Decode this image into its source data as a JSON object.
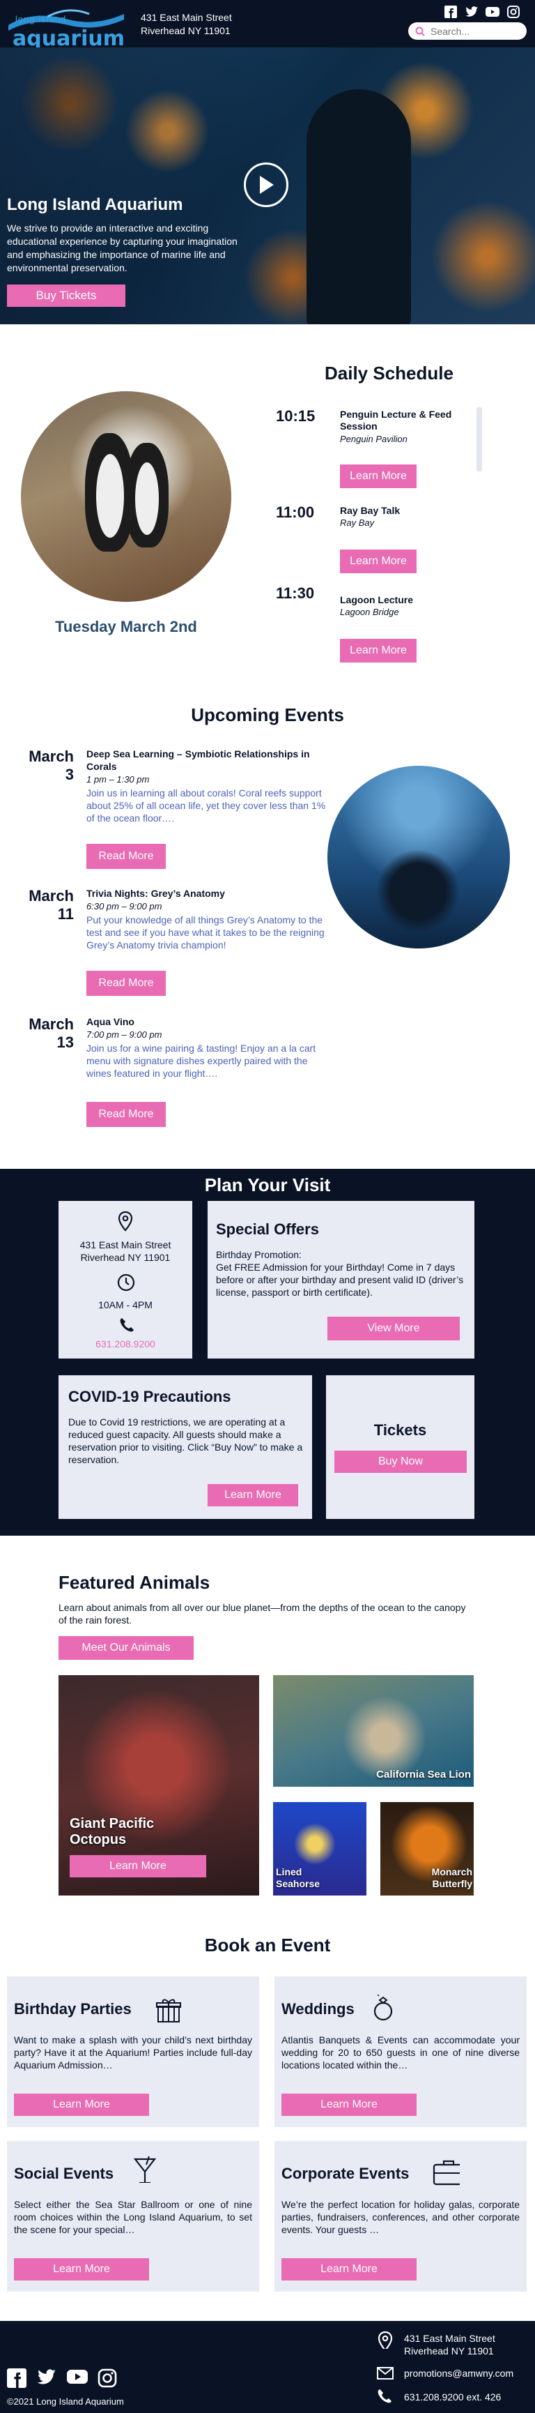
{
  "header": {
    "logo_top": "long island",
    "logo_main": "aquarium",
    "address_line1": "431 East Main Street",
    "address_line2": "Riverhead NY 11901",
    "search_placeholder": "Search...",
    "social_icons": [
      "facebook-icon",
      "twitter-icon",
      "youtube-icon",
      "instagram-icon"
    ]
  },
  "hero": {
    "title": "Long Island Aquarium",
    "description": "We strive to provide an interactive and exciting educational experience by capturing your imagination and emphasizing the importance of marine life and environmental preservation.",
    "button": "Buy Tickets"
  },
  "schedule": {
    "title": "Daily Schedule",
    "date": "Tuesday March 2nd",
    "items": [
      {
        "time": "10:15",
        "name": "Penguin Lecture & Feed Session",
        "location": "Penguin Pavilion",
        "button": "Learn More"
      },
      {
        "time": "11:00",
        "name": "Ray Bay Talk",
        "location": "Ray Bay",
        "button": "Learn More"
      },
      {
        "time": "11:30",
        "name": "Lagoon Lecture",
        "location": "Lagoon Bridge",
        "button": "Learn More"
      }
    ]
  },
  "events": {
    "title": "Upcoming Events",
    "items": [
      {
        "month": "March",
        "day": "3",
        "name": "Deep Sea Learning – Symbiotic Relationships in Corals",
        "time": "1 pm – 1:30 pm",
        "description": "Join us in learning all about corals! Coral reefs support about 25% of all ocean life, yet they cover less than 1% of the ocean floor….",
        "button": "Read More"
      },
      {
        "month": "March",
        "day": "11",
        "name": "Trivia Nights: Grey’s Anatomy",
        "time": "6:30 pm – 9:00 pm",
        "description": "Put your knowledge of all things Grey’s Anatomy to the test and see if you have what it takes to be the reigning Grey’s Anatomy trivia champion!",
        "button": "Read More"
      },
      {
        "month": "March",
        "day": "13",
        "name": "Aqua Vino",
        "time": "7:00 pm – 9:00 pm",
        "description": "Join us for a wine pairing & tasting! Enjoy an a la cart menu with signature dishes expertly paired with the wines featured in your flight….",
        "button": "Read More"
      }
    ]
  },
  "plan": {
    "title": "Plan Your Visit",
    "address_line1": "431 East Main Street",
    "address_line2": "Riverhead NY 11901",
    "hours": "10AM - 4PM",
    "phone": "631.208.9200",
    "offers_title": "Special Offers",
    "offers_subtitle": "Birthday Promotion:",
    "offers_text": "Get FREE Admission for your Birthday! Come in 7 days before or after your birthday and present valid ID (driver’s license, passport or birth certificate).",
    "offers_button": "View More",
    "covid_title": "COVID-19 Precautions",
    "covid_text": "Due to Covid 19 restrictions, we are operating at a reduced guest capacity. All guests should make a reservation prior to visiting. Click “Buy Now” to make a reservation.",
    "covid_button": "Learn More",
    "tickets_title": "Tickets",
    "tickets_button": "Buy Now"
  },
  "featured": {
    "title": "Featured Animals",
    "description": "Learn about animals from all over our blue planet—from the depths of the ocean to the canopy of the rain forest.",
    "button": "Meet Our Animals",
    "octopus_label": "Giant Pacific Octopus",
    "octopus_button": "Learn More",
    "sealion_label": "California Sea Lion",
    "seahorse_label": "Lined Seahorse",
    "butterfly_label": "Monarch Butterfly"
  },
  "book": {
    "title": "Book an Event",
    "cards": [
      {
        "title": "Birthday Parties",
        "text": "Want to make a splash with your child’s next birthday party? Have it at the Aquarium! Parties include full-day Aquarium Admission…",
        "button": "Learn More",
        "icon": "gift-icon"
      },
      {
        "title": "Weddings",
        "text": "Atlantis Banquets & Events can accommodate your wedding for 20 to 650 guests in one of nine diverse locations located within the…",
        "button": "Learn More",
        "icon": "ring-icon"
      },
      {
        "title": "Social Events",
        "text": "Select either the Sea Star Ballroom or one of nine room choices within the Long Island Aquarium, to set the scene for your special…",
        "button": "Learn More",
        "icon": "cocktail-icon"
      },
      {
        "title": "Corporate Events",
        "text": "We’re the perfect location for holiday galas, corporate parties, fundraisers, conferences, and other corporate events. Your guests …",
        "button": "Learn More",
        "icon": "briefcase-icon"
      }
    ]
  },
  "footer": {
    "address_line1": "431 East Main Street",
    "address_line2": "Riverhead NY 11901",
    "email": "promotions@amwny.com",
    "phone": "631.208.9200 ext. 426",
    "copyright": "©2021 Long Island Aquarium"
  },
  "colors": {
    "navy": "#0a1326",
    "pink": "#e86bb3",
    "card": "#e8ebf4",
    "blue_text": "#4e63b8"
  }
}
